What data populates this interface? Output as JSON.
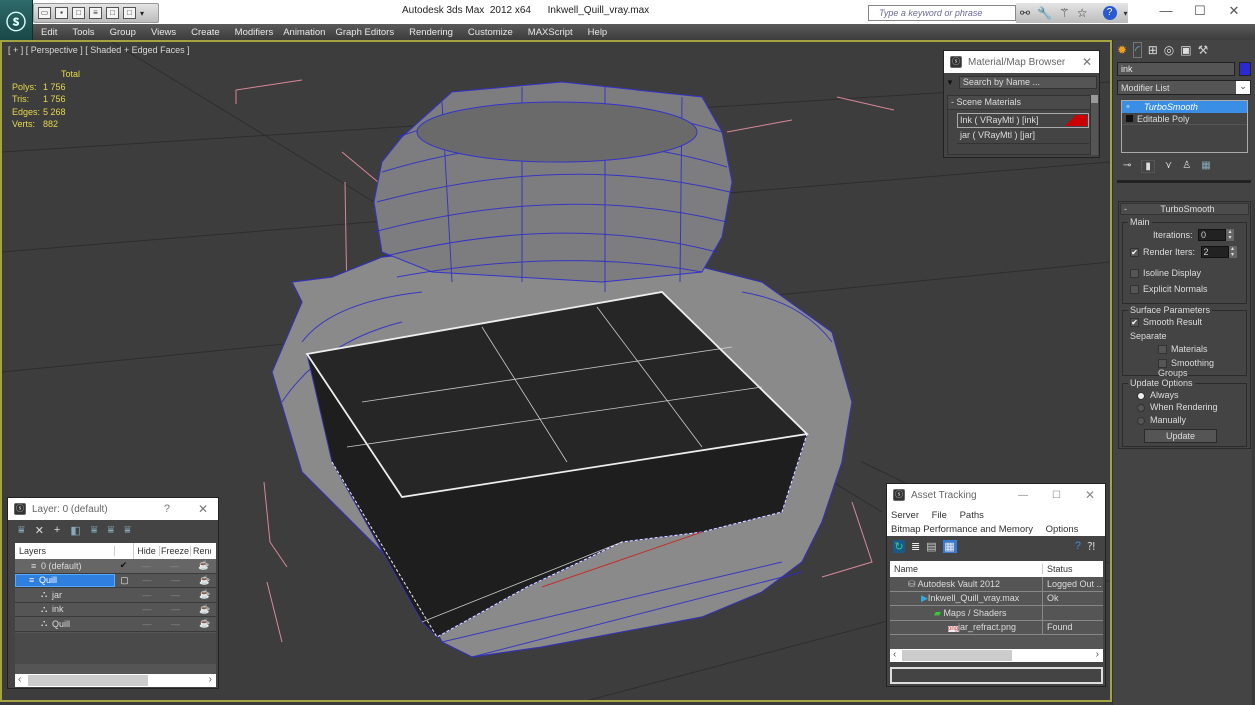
{
  "window": {
    "app_title": "Autodesk 3ds Max  2012 x64",
    "file_name": "Inkwell_Quill_vray.max",
    "search_placeholder": "Type a keyword or phrase",
    "minimize": "—",
    "maximize": "☐",
    "close": "✕",
    "help_icon": "?",
    "qat_icons": [
      "open-file-icon",
      "save-icon",
      "new-scene-icon",
      "hold-icon",
      "undo-icon",
      "redo-icon",
      "dropdown-icon"
    ]
  },
  "menu": [
    "Edit",
    "Tools",
    "Group",
    "Views",
    "Create",
    "Modifiers",
    "Animation",
    "Graph Editors",
    "Rendering",
    "Customize",
    "MAXScript",
    "Help"
  ],
  "viewport": {
    "label": "[ + ] [ Perspective ] [ Shaded + Edged Faces ]",
    "stats": {
      "header": "Total",
      "rows": [
        {
          "label": "Polys:",
          "value": "1 756"
        },
        {
          "label": "Tris:",
          "value": "1 756"
        },
        {
          "label": "Edges:",
          "value": "5 268"
        },
        {
          "label": "Verts:",
          "value": "882"
        }
      ]
    }
  },
  "material_browser": {
    "title": "Material/Map Browser",
    "search_placeholder": "Search by Name ...",
    "section": "- Scene Materials",
    "items": [
      {
        "label": "Ink  ( VRayMtl ) [ink]",
        "swatch": "#cc0000",
        "selected": true
      },
      {
        "label": "jar  ( VRayMtl ) [jar]",
        "swatch": null,
        "selected": false
      }
    ]
  },
  "command_panel": {
    "tabs": [
      "create-icon",
      "modify-icon",
      "hierarchy-icon",
      "motion-icon",
      "display-icon",
      "utilities-icon"
    ],
    "object_name": "ink",
    "object_color": "#2a2ad0",
    "modifier_list_label": "Modifier List",
    "stack": [
      {
        "label": "TurboSmooth",
        "selected": true
      },
      {
        "label": "Editable Poly",
        "selected": false
      }
    ],
    "turbosmooth": {
      "title": "TurboSmooth",
      "main_label": "Main",
      "iterations_label": "Iterations:",
      "iterations_value": "0",
      "render_iters_label": "Render Iters:",
      "render_iters_value": "2",
      "render_iters_checked": true,
      "isoline_label": "Isoline Display",
      "isoline_checked": false,
      "explicit_normals_label": "Explicit Normals",
      "explicit_normals_checked": false,
      "surface_label": "Surface Parameters",
      "smooth_result_label": "Smooth Result",
      "smooth_result_checked": true,
      "separate_label": "Separate",
      "materials_label": "Materials",
      "smoothing_groups_label": "Smoothing Groups",
      "update_options_label": "Update Options",
      "radio_always": "Always",
      "radio_when_rendering": "When Rendering",
      "radio_manually": "Manually",
      "selected_update": "Always",
      "update_button": "Update"
    }
  },
  "layer_window": {
    "title": "Layer: 0 (default)",
    "help": "?",
    "close": "✕",
    "columns": [
      "Layers",
      "",
      "Hide",
      "Freeze",
      "Rend"
    ],
    "rows": [
      {
        "name": "0 (default)",
        "indent": 1,
        "type": "layer",
        "current": true,
        "selected": false
      },
      {
        "name": "Quill",
        "indent": 1,
        "type": "layer",
        "current": false,
        "selected": true
      },
      {
        "name": "jar",
        "indent": 2,
        "type": "object",
        "current": false,
        "selected": false
      },
      {
        "name": "ink",
        "indent": 2,
        "type": "object",
        "current": false,
        "selected": false
      },
      {
        "name": "Quill",
        "indent": 2,
        "type": "object",
        "current": false,
        "selected": false
      }
    ]
  },
  "asset_tracking": {
    "title": "Asset Tracking",
    "menu1": [
      "Server",
      "File",
      "Paths"
    ],
    "menu2": [
      "Bitmap Performance and Memory",
      "Options"
    ],
    "columns": [
      "Name",
      "Status"
    ],
    "rows": [
      {
        "name": "Autodesk Vault 2012",
        "status": "Logged Out ..",
        "indent": 1
      },
      {
        "name": "Inkwell_Quill_vray.max",
        "status": "Ok",
        "indent": 2
      },
      {
        "name": "Maps / Shaders",
        "status": "",
        "indent": 3
      },
      {
        "name": "jar_refract.png",
        "status": "Found",
        "indent": 4
      }
    ]
  }
}
